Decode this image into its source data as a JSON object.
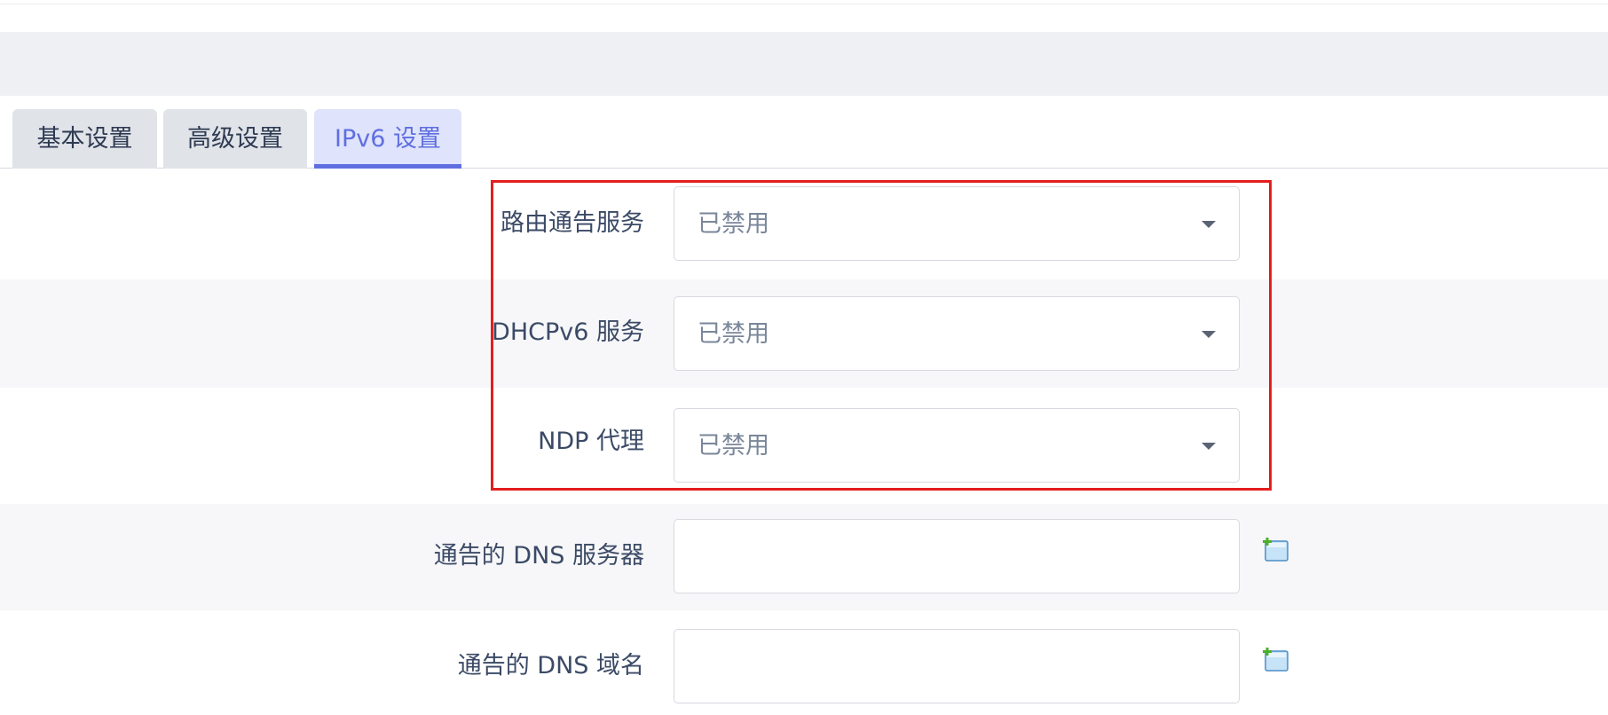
{
  "tabs": [
    {
      "label": "基本设置",
      "active": false
    },
    {
      "label": "高级设置",
      "active": false
    },
    {
      "label": "IPv6 设置",
      "active": true
    }
  ],
  "fields": {
    "ra_service": {
      "label": "路由通告服务",
      "value": "已禁用"
    },
    "dhcpv6_service": {
      "label": "DHCPv6 服务",
      "value": "已禁用"
    },
    "ndp_proxy": {
      "label": "NDP 代理",
      "value": "已禁用"
    },
    "dns_servers": {
      "label": "通告的 DNS 服务器",
      "value": ""
    },
    "dns_domains": {
      "label": "通告的 DNS 域名",
      "value": ""
    }
  },
  "icons": {
    "add": "add-item-icon"
  },
  "colors": {
    "accent": "#5f6fe0",
    "highlight": "#e41e1e"
  }
}
